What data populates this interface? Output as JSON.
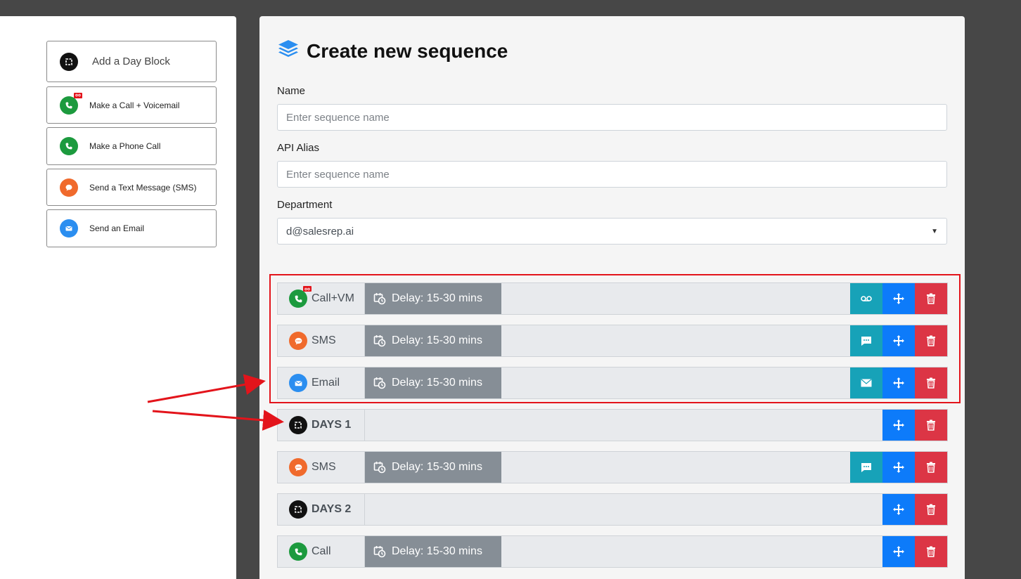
{
  "sidebar": {
    "blocks": [
      {
        "label": "Add a Day Block",
        "icon": "day-block-icon"
      },
      {
        "label": "Make a Call + Voicemail",
        "icon": "phone-voicemail-icon"
      },
      {
        "label": "Make a Phone Call",
        "icon": "phone-icon"
      },
      {
        "label": "Send a Text Message (SMS)",
        "icon": "sms-icon"
      },
      {
        "label": "Send an Email",
        "icon": "email-icon"
      }
    ]
  },
  "main": {
    "title": "Create new sequence",
    "name_label": "Name",
    "name_placeholder": "Enter sequence name",
    "alias_label": "API Alias",
    "alias_placeholder": "Enter sequence name",
    "department_label": "Department",
    "department_value": "d@salesrep.ai"
  },
  "sequence": [
    {
      "type": "Call+VM",
      "delay": "Delay: 15-30 mins"
    },
    {
      "type": "SMS",
      "delay": "Delay: 15-30 mins"
    },
    {
      "type": "Email",
      "delay": "Delay: 15-30 mins"
    },
    {
      "type": "DAYS 1"
    },
    {
      "type": "SMS",
      "delay": "Delay: 15-30 mins"
    },
    {
      "type": "DAYS 2"
    },
    {
      "type": "Call",
      "delay": "Delay: 15-30 mins"
    }
  ],
  "colors": {
    "accent_blue": "#0d7bfa",
    "danger_red": "#dc3545",
    "info_teal": "#17a2b8",
    "delay_gray": "#868e96",
    "annotation_red": "#e3141b"
  }
}
